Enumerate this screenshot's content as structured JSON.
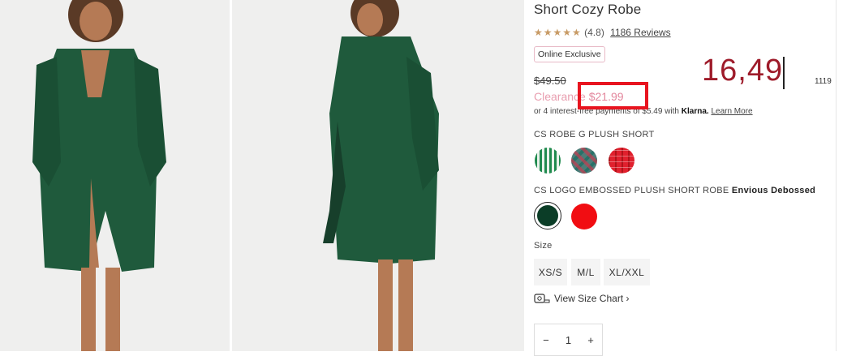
{
  "product": {
    "title": "Short Cozy Robe",
    "stars": "★★★★★",
    "rating": "(4.8)",
    "reviews": "1186 Reviews",
    "badge": "Online Exclusive",
    "old_price": "$49.50",
    "clearance_label": "Clearance",
    "clearance_price": "$21.99",
    "klarna_text": "or 4 interest-free payments of $5.49 with",
    "klarna_brand": "Klarna.",
    "klarna_link": "Learn More"
  },
  "overlay": {
    "big_price": "16,49",
    "side_number": "1119"
  },
  "options": {
    "pattern_label": "CS ROBE G PLUSH SHORT",
    "color_label": "CS LOGO EMBOSSED PLUSH SHORT ROBE",
    "color_selected": "Envious Debossed"
  },
  "size": {
    "label": "Size",
    "options": [
      "XS/S",
      "M/L",
      "XL/XXL"
    ],
    "chart_link": "View Size Chart ›"
  },
  "quantity": {
    "minus": "−",
    "value": "1",
    "plus": "+"
  },
  "colors": {
    "robe_green": "#1f5a3c",
    "highlight": "#e8141f",
    "price_red": "#9e1b2a",
    "clearance_pink": "#e3869c"
  }
}
